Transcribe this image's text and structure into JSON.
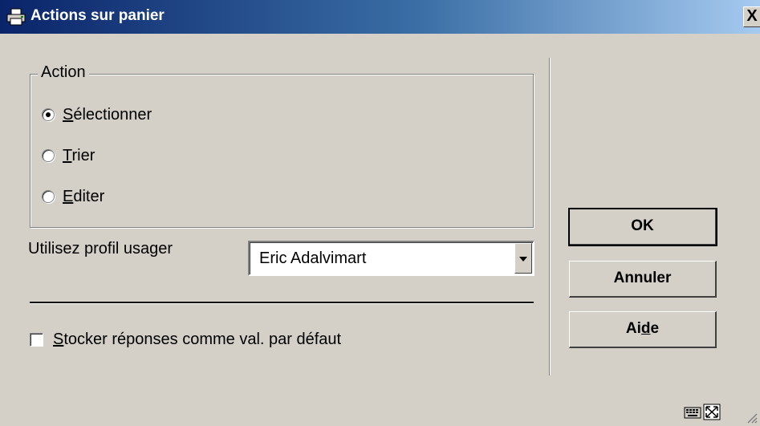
{
  "window": {
    "title": "Actions sur panier",
    "close_label": "X"
  },
  "action_group": {
    "legend": "Action",
    "options": [
      {
        "mnemonic": "S",
        "rest": "électionner",
        "checked": true
      },
      {
        "mnemonic": "T",
        "rest": "rier",
        "checked": false
      },
      {
        "mnemonic": "E",
        "rest": "diter",
        "checked": false
      }
    ]
  },
  "profile": {
    "label": "Utilisez profil usager",
    "selected_value": "Eric Adalvimart"
  },
  "store_defaults": {
    "mnemonic": "S",
    "rest": "tocker réponses comme val. par défaut",
    "checked": false
  },
  "buttons": {
    "ok": "OK",
    "cancel": "Annuler",
    "help_pre": "Ai",
    "help_mnemonic": "d",
    "help_post": "e"
  },
  "icons": {
    "title": "printer-icon",
    "status": [
      "keyboard-icon",
      "resize-icon"
    ],
    "grip": "size-grip-icon"
  }
}
